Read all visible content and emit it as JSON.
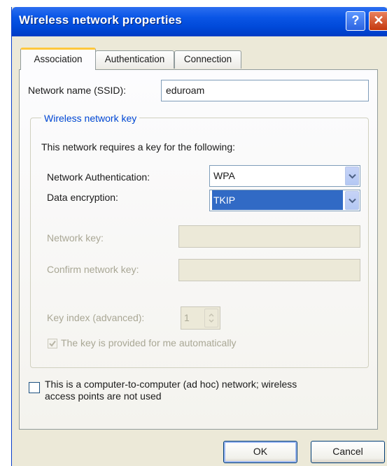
{
  "window": {
    "title": "Wireless network properties",
    "help_glyph": "?",
    "close_glyph": "✕"
  },
  "tabs": [
    {
      "label": "Association",
      "active": true
    },
    {
      "label": "Authentication",
      "active": false
    },
    {
      "label": "Connection",
      "active": false
    }
  ],
  "association": {
    "ssid_label": "Network name (SSID):",
    "ssid_value": "eduroam",
    "group_title": "Wireless network key",
    "requires_text": "This network requires a key for the following:",
    "auth_label": "Network Authentication:",
    "auth_value": "WPA",
    "encryption_label": "Data encryption:",
    "encryption_value": "TKIP",
    "network_key_label": "Network key:",
    "network_key_value": "",
    "confirm_key_label": "Confirm network key:",
    "confirm_key_value": "",
    "key_index_label": "Key index (advanced):",
    "key_index_value": "1",
    "auto_key_label": "The key is provided for me automatically",
    "auto_key_checked": true,
    "adhoc_label_line1": "This is a computer-to-computer (ad hoc) network; wireless",
    "adhoc_label_line2": "access points are not used",
    "adhoc_checked": false
  },
  "buttons": {
    "ok": "OK",
    "cancel": "Cancel"
  },
  "colors": {
    "titlebar": "#0a56e6",
    "dialog_bg": "#ece9d8",
    "group_title": "#0046d5",
    "selection": "#316ac5",
    "disabled_text": "#a9a795",
    "active_tab_highlight": "#ffc83c"
  }
}
